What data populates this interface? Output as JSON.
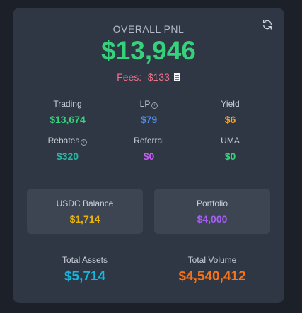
{
  "header": {
    "title": "OVERALL PNL",
    "value": "$13,946",
    "fees": "Fees: -$133",
    "refresh_icon": "refresh-icon",
    "fees_icon": "receipt-icon"
  },
  "stats": [
    {
      "label": "Trading",
      "value": "$13,674",
      "color": "#34d27b",
      "info": false
    },
    {
      "label": "LP",
      "value": "$79",
      "color": "#4f8fe8",
      "info": true
    },
    {
      "label": "Yield",
      "value": "$6",
      "color": "#f5a524",
      "info": false
    },
    {
      "label": "Rebates",
      "value": "$320",
      "color": "#2bb5a3",
      "info": true
    },
    {
      "label": "Referral",
      "value": "$0",
      "color": "#c15ef0",
      "info": false
    },
    {
      "label": "UMA",
      "value": "$0",
      "color": "#34d27b",
      "info": false
    }
  ],
  "balances": {
    "usdc": {
      "label": "USDC Balance",
      "value": "$1,714",
      "color": "#eab308"
    },
    "portfolio": {
      "label": "Portfolio",
      "value": "$4,000",
      "color": "#a65ef5"
    }
  },
  "totals": {
    "assets": {
      "label": "Total Assets",
      "value": "$5,714",
      "color": "#11b8df"
    },
    "volume": {
      "label": "Total Volume",
      "value": "$4,540,412",
      "color": "#f97316"
    }
  }
}
